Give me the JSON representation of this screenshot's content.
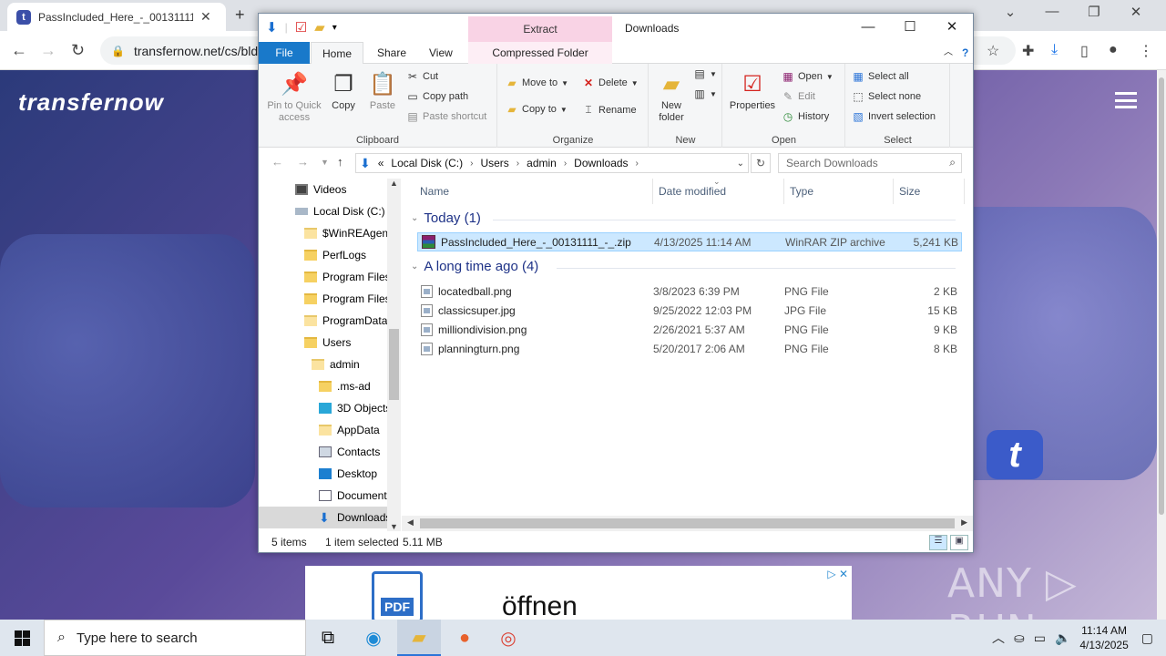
{
  "browser": {
    "tab_title": "PassIncluded_Here_-_00131111_",
    "tab_favicon": "t",
    "close_tab": "✕",
    "new_tab": "+",
    "url": "transfernow.net/cs/bld3",
    "win_minimize": "—",
    "win_restore": "❐",
    "win_close": "✕"
  },
  "page": {
    "brand": "transfernow",
    "logo_letter": "t",
    "ad_text": "öffnen",
    "ad_pdf": "PDF",
    "ad_close": "▷ ✕"
  },
  "watermark": "ANY ▷ RUN",
  "explorer": {
    "title": "Downloads",
    "context_header": "Extract",
    "tabs": {
      "file": "File",
      "home": "Home",
      "share": "Share",
      "view": "View",
      "cft": "Compressed Folder Tools"
    },
    "clipboard": {
      "pin": "Pin to Quick access",
      "copy": "Copy",
      "paste": "Paste",
      "cut": "Cut",
      "copy_path": "Copy path",
      "paste_shortcut": "Paste shortcut",
      "label": "Clipboard"
    },
    "organize": {
      "move_to": "Move to",
      "copy_to": "Copy to",
      "delete": "Delete",
      "rename": "Rename",
      "label": "Organize"
    },
    "new": {
      "new_folder": "New folder",
      "label": "New"
    },
    "open": {
      "properties": "Properties",
      "open": "Open",
      "edit": "Edit",
      "history": "History",
      "label": "Open"
    },
    "select": {
      "select_all": "Select all",
      "select_none": "Select none",
      "invert": "Invert selection",
      "label": "Select"
    },
    "address": {
      "prefix": "«",
      "segments": [
        "Local Disk (C:)",
        "Users",
        "admin",
        "Downloads"
      ]
    },
    "search_placeholder": "Search Downloads",
    "nav": [
      {
        "label": "Videos"
      },
      {
        "label": "Local Disk (C:)"
      },
      {
        "label": "$WinREAgent"
      },
      {
        "label": "PerfLogs"
      },
      {
        "label": "Program Files"
      },
      {
        "label": "Program Files"
      },
      {
        "label": "ProgramData"
      },
      {
        "label": "Users"
      },
      {
        "label": "admin"
      },
      {
        "label": ".ms-ad"
      },
      {
        "label": "3D Objects"
      },
      {
        "label": "AppData"
      },
      {
        "label": "Contacts"
      },
      {
        "label": "Desktop"
      },
      {
        "label": "Documents"
      },
      {
        "label": "Downloads"
      }
    ],
    "columns": {
      "name": "Name",
      "date": "Date modified",
      "type": "Type",
      "size": "Size"
    },
    "groups": [
      {
        "label": "Today (1)"
      },
      {
        "label": "A long time ago (4)"
      }
    ],
    "files": [
      {
        "name": "PassIncluded_Here_-_00131111_-_.zip",
        "date": "4/13/2025 11:14 AM",
        "type": "WinRAR ZIP archive",
        "size": "5,241 KB"
      },
      {
        "name": "locatedball.png",
        "date": "3/8/2023 6:39 PM",
        "type": "PNG File",
        "size": "2 KB"
      },
      {
        "name": "classicsuper.jpg",
        "date": "9/25/2022 12:03 PM",
        "type": "JPG File",
        "size": "15 KB"
      },
      {
        "name": "milliondivision.png",
        "date": "2/26/2021 5:37 AM",
        "type": "PNG File",
        "size": "9 KB"
      },
      {
        "name": "planningturn.png",
        "date": "5/20/2017 2:06 AM",
        "type": "PNG File",
        "size": "8 KB"
      }
    ],
    "status": {
      "items": "5 items",
      "selected": "1 item selected",
      "size": "5.11 MB"
    }
  },
  "taskbar": {
    "search_placeholder": "Type here to search",
    "time": "11:14 AM",
    "date": "4/13/2025"
  }
}
